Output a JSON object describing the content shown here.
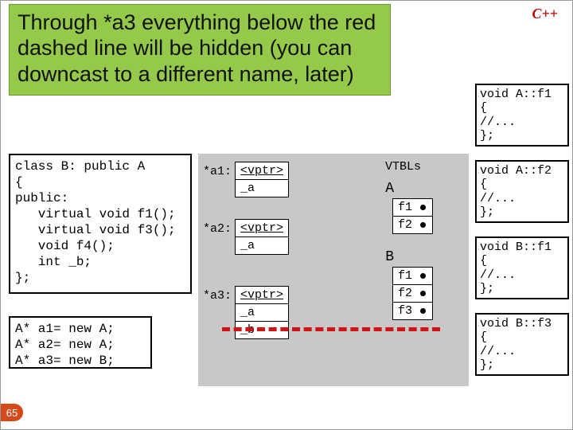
{
  "header": {
    "lang_label": "C++"
  },
  "callout": {
    "text": "Through *a3 everything below the red dashed line will be hidden (you can downcast to a different name, later)"
  },
  "code": {
    "classB": "class B: public A\n{\npublic:\n   virtual void f1();\n   virtual void f3();\n   void f4();\n   int _b;\n};",
    "instances": "A* a1= new A;\nA* a2= new A;\nA* a3= new B;",
    "fn_A_f1": "void A::f1\n{\n//...\n};",
    "fn_A_f2": "void A::f2\n{\n//...\n};",
    "fn_B_f1": "void B::f1\n{\n//...\n};",
    "fn_B_f3": "void B::f3\n{\n//...\n};"
  },
  "objects": {
    "a1": {
      "label": "*a1:",
      "rows": [
        "<vptr>",
        "_a"
      ]
    },
    "a2": {
      "label": "*a2:",
      "rows": [
        "<vptr>",
        "_a"
      ]
    },
    "a3": {
      "label": "*a3:",
      "rows": [
        "<vptr>",
        "_a",
        "_b"
      ]
    }
  },
  "vtbls": {
    "heading": "VTBLs",
    "A": {
      "title": "A",
      "rows": [
        "f1",
        "f2"
      ]
    },
    "B": {
      "title": "B",
      "rows": [
        "f1",
        "f2",
        "f3"
      ]
    }
  },
  "page": {
    "number": "65"
  }
}
